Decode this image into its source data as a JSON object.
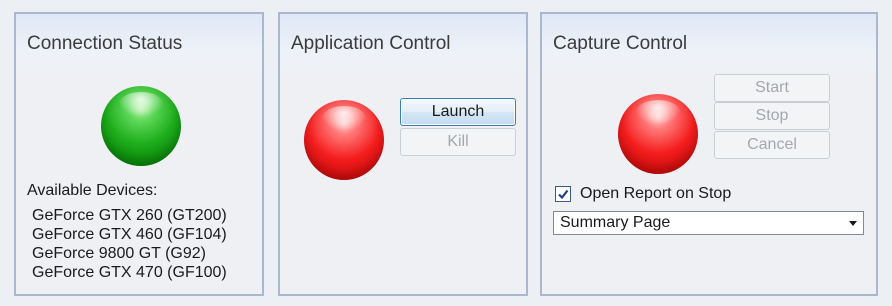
{
  "connection": {
    "title": "Connection Status",
    "status_indicator": "connected-green",
    "devices_label": "Available Devices:",
    "devices": [
      "GeForce GTX 260 (GT200)",
      "GeForce GTX 460 (GF104)",
      "GeForce 9800 GT (G92)",
      "GeForce GTX 470 (GF100)"
    ]
  },
  "application": {
    "title": "Application Control",
    "status_indicator": "stopped-red",
    "launch_label": "Launch",
    "kill_label": "Kill"
  },
  "capture": {
    "title": "Capture Control",
    "status_indicator": "stopped-red",
    "start_label": "Start",
    "stop_label": "Stop",
    "cancel_label": "Cancel",
    "open_report_label": "Open Report on Stop",
    "open_report_checked": true,
    "report_page_selected": "Summary Page"
  },
  "colors": {
    "panel_border": "#a9b8cf",
    "header_gradient_top": "#dfe8f6",
    "led_green": "#1fae1c",
    "led_red": "#f51e1e",
    "button_accent": "#3c7fb1",
    "disabled_text": "#a3a8ae"
  }
}
